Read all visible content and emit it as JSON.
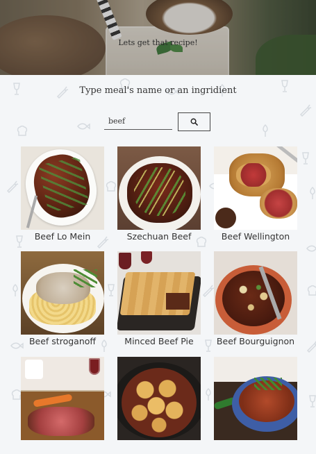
{
  "hero": {
    "caption": "Lets get that recipe!"
  },
  "search": {
    "prompt": "Type meal's name or an ingridient",
    "value": "beef",
    "button_icon": "search-icon"
  },
  "recipes": [
    {
      "title": "Beef Lo Mein"
    },
    {
      "title": "Szechuan Beef"
    },
    {
      "title": "Beef Wellington"
    },
    {
      "title": "Beef stroganoff"
    },
    {
      "title": "Minced Beef Pie"
    },
    {
      "title": "Beef Bourguignon"
    },
    {
      "title": ""
    },
    {
      "title": ""
    },
    {
      "title": ""
    }
  ],
  "colors": {
    "background": "#f4f6f8",
    "text": "#333333",
    "doodle": "#d6dbe0"
  }
}
